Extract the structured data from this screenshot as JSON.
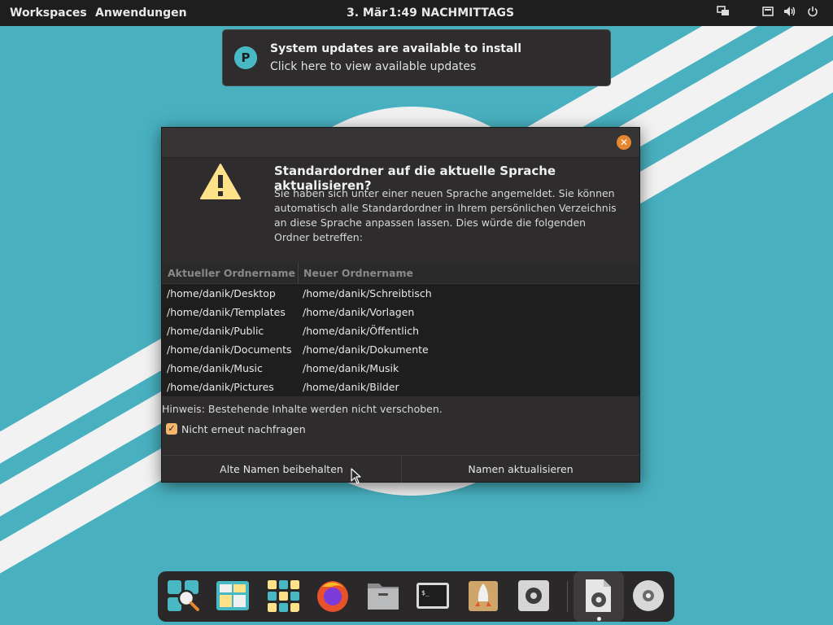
{
  "topbar": {
    "workspaces": "Workspaces",
    "applications": "Anwendungen",
    "date": "3. Mär",
    "time": "1:49 NACHMITTAGS",
    "tray_icons": [
      "display-icon",
      "keyboard-icon",
      "volume-icon",
      "power-icon"
    ]
  },
  "notification": {
    "title": "System updates are available to install",
    "body": "Click here to view available updates",
    "icon": "pop-shop-icon"
  },
  "dialog": {
    "title": "Standardordner auf die aktuelle Sprache aktualisieren?",
    "text_lines": [
      "Sie haben sich unter einer neuen Sprache angemeldet. Sie können",
      "automatisch alle Standardordner in Ihrem persönlichen Verzeichnis",
      "an diese Sprache anpassen lassen. Dies würde die folgenden",
      "Ordner betreffen:"
    ],
    "columns": [
      "Aktueller Ordnername",
      "Neuer Ordnername"
    ],
    "rows": [
      [
        "/home/danik/Desktop",
        "/home/danik/Schreibtisch"
      ],
      [
        "/home/danik/Templates",
        "/home/danik/Vorlagen"
      ],
      [
        "/home/danik/Public",
        "/home/danik/Öffentlich"
      ],
      [
        "/home/danik/Documents",
        "/home/danik/Dokumente"
      ],
      [
        "/home/danik/Music",
        "/home/danik/Musik"
      ],
      [
        "/home/danik/Pictures",
        "/home/danik/Bilder"
      ]
    ],
    "hint": "Hinweis: Bestehende Inhalte werden nicht verschoben.",
    "checkbox_label": "Nicht erneut nachfragen",
    "checkbox_checked": true,
    "keep_button": "Alte Namen beibehalten",
    "update_button": "Namen aktualisieren"
  },
  "dock": {
    "items": [
      "launcher-icon",
      "workspaces-icon",
      "app-grid-icon",
      "firefox-icon",
      "files-icon",
      "terminal-icon",
      "pop-shop-icon",
      "settings-icon",
      "document-settings-icon",
      "disc-icon"
    ]
  },
  "colors": {
    "accent": "#48b9c4",
    "close": "#e6862f",
    "checkbox": "#f5b56a",
    "warning": "#fde28a"
  }
}
